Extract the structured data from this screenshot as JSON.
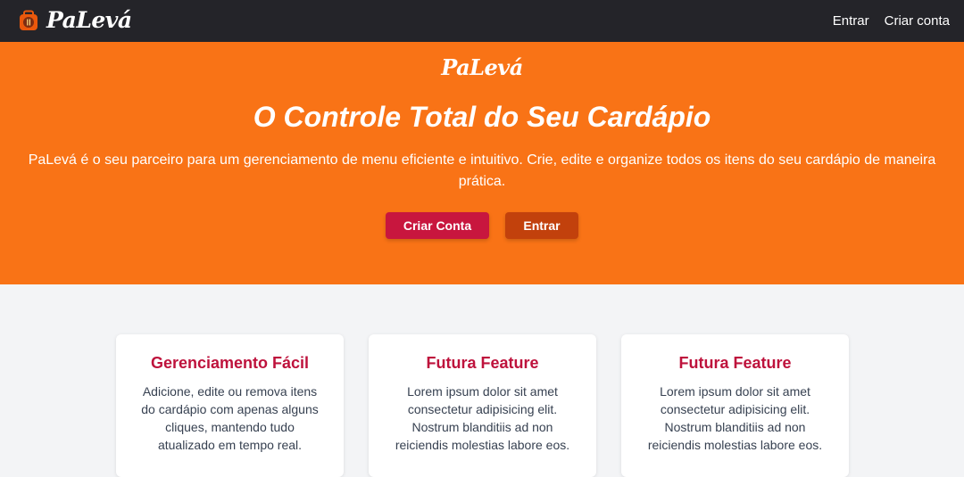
{
  "navbar": {
    "brand": "PaLevá",
    "links": [
      {
        "label": "Entrar"
      },
      {
        "label": "Criar conta"
      }
    ]
  },
  "hero": {
    "brand": "PaLevá",
    "title": "O Controle Total do Seu Cardápio",
    "description": "PaLevá é o seu parceiro para um gerenciamento de menu eficiente e intuitivo. Crie, edite e organize todos os itens do seu cardápio de maneira prática.",
    "primary_button": "Criar Conta",
    "secondary_button": "Entrar"
  },
  "features": [
    {
      "title": "Gerenciamento Fácil",
      "text": "Adicione, edite ou remova itens do cardápio com apenas alguns cliques, mantendo tudo atualizado em tempo real."
    },
    {
      "title": "Futura Feature",
      "text": "Lorem ipsum dolor sit amet consectetur adipisicing elit. Nostrum blanditiis ad non reiciendis molestias labore eos."
    },
    {
      "title": "Futura Feature",
      "text": "Lorem ipsum dolor sit amet consectetur adipisicing elit. Nostrum blanditiis ad non reiciendis molestias labore eos."
    }
  ],
  "colors": {
    "navbar_bg": "#242429",
    "hero_bg": "#f97316",
    "primary_button": "#c8163e",
    "secondary_button": "#c2410c",
    "card_title": "#be123c",
    "page_bg": "#f3f4f6"
  },
  "icons": {
    "logo": "takeaway-bag-icon"
  }
}
